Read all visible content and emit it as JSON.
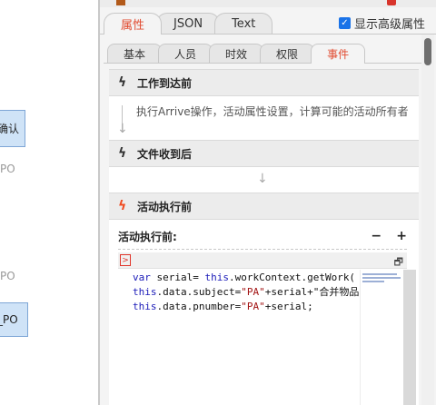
{
  "canvas": {
    "node1_text": "确认",
    "node1_label": "PO",
    "node2_label": "PO",
    "node2_text": "_PO"
  },
  "main_tabs": [
    {
      "label": "属性",
      "active": true
    },
    {
      "label": "JSON",
      "active": false
    },
    {
      "label": "Text",
      "active": false
    }
  ],
  "show_advanced": {
    "label": "显示高级属性",
    "checked": true
  },
  "sub_tabs": [
    {
      "label": "基本",
      "active": false
    },
    {
      "label": "人员",
      "active": false
    },
    {
      "label": "时效",
      "active": false
    },
    {
      "label": "权限",
      "active": false
    },
    {
      "label": "事件",
      "active": true
    }
  ],
  "events": {
    "arrive": {
      "title": "工作到达前",
      "desc": "执行Arrive操作，活动属性设置，计算可能的活动所有者"
    },
    "after_received": {
      "title": "文件收到后"
    },
    "before_execute": {
      "title": "活动执行前"
    }
  },
  "script": {
    "title": "活动执行前:",
    "minus": "−",
    "plus": "+",
    "lines": [
      {
        "kw1": "var",
        "t1": " serial= ",
        "kw2": "this",
        "t2": ".workContext.getWork(",
        "str": "",
        "t3": ""
      },
      {
        "kw1": "this",
        "t1": ".data.subject=",
        "kw2": "",
        "t2": "",
        "str": "\"PA\"",
        "t3": "+serial+\"合并物品"
      },
      {
        "kw1": "this",
        "t1": ".data.pnumber=",
        "kw2": "",
        "t2": "",
        "str": "\"PA\"",
        "t3": "+serial;"
      }
    ]
  },
  "accent_color": "#e14b31"
}
